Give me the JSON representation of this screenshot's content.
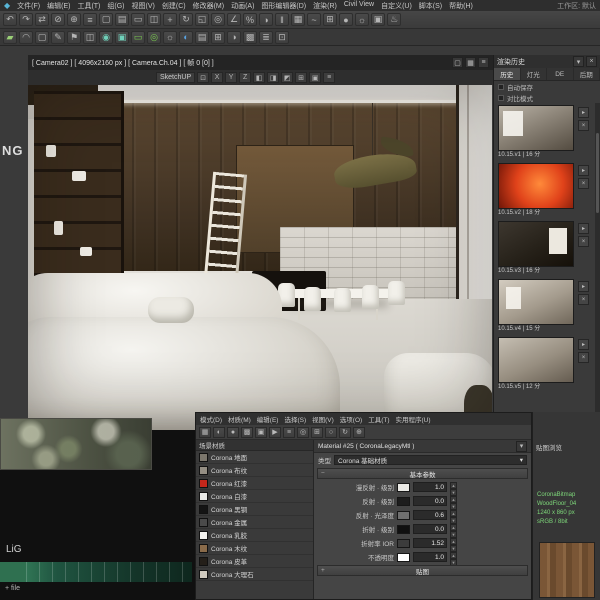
{
  "app": {
    "logo_glyph": "◆",
    "workspace_label": "工作区: 默认"
  },
  "menubar": {
    "items": [
      "文件(F)",
      "编辑(E)",
      "工具(T)",
      "组(G)",
      "视图(V)",
      "创建(C)",
      "修改器(M)",
      "动画(A)",
      "图形编辑器(D)",
      "渲染(R)",
      "Civil View",
      "自定义(U)",
      "脚本(S)",
      "帮助(H)"
    ]
  },
  "toolbar_main": {
    "icons": [
      {
        "name": "undo-icon",
        "glyph": "↶"
      },
      {
        "name": "redo-icon",
        "glyph": "↷"
      },
      {
        "name": "select-and-link-icon",
        "glyph": "⇄"
      },
      {
        "name": "unlink-selection-icon",
        "glyph": "⊘"
      },
      {
        "name": "bind-to-space-warp-icon",
        "glyph": "⊕"
      },
      {
        "name": "selection-filter-dropdown",
        "glyph": "≡"
      },
      {
        "name": "select-object-icon",
        "glyph": "▢"
      },
      {
        "name": "select-by-name-icon",
        "glyph": "▤"
      },
      {
        "name": "rectangular-selection-icon",
        "glyph": "▭"
      },
      {
        "name": "window-crossing-icon",
        "glyph": "◫"
      },
      {
        "name": "select-and-move-icon",
        "glyph": "+"
      },
      {
        "name": "select-and-rotate-icon",
        "glyph": "↻"
      },
      {
        "name": "select-and-scale-icon",
        "glyph": "◱"
      },
      {
        "name": "snap-toggle-icon",
        "glyph": "◎"
      },
      {
        "name": "angle-snap-icon",
        "glyph": "∠"
      },
      {
        "name": "percent-snap-icon",
        "glyph": "%"
      },
      {
        "name": "mirror-icon",
        "glyph": "◑"
      },
      {
        "name": "align-icon",
        "glyph": "‖"
      },
      {
        "name": "layer-manager-icon",
        "glyph": "▦"
      },
      {
        "name": "curve-editor-icon",
        "glyph": "~"
      },
      {
        "name": "schematic-view-icon",
        "glyph": "⊞"
      },
      {
        "name": "material-editor-icon",
        "glyph": "●"
      },
      {
        "name": "render-setup-icon",
        "glyph": "☼"
      },
      {
        "name": "render-frame-window-icon",
        "glyph": "▣"
      },
      {
        "name": "render-production-icon",
        "glyph": "♨"
      }
    ]
  },
  "toolbar_second": {
    "icons": [
      {
        "name": "modeling-tab-icon",
        "glyph": "▰",
        "fg": "#9ad076"
      },
      {
        "name": "freeform-tab-icon",
        "glyph": "◠"
      },
      {
        "name": "selection-tab-icon",
        "glyph": "▢"
      },
      {
        "name": "object-paint-icon",
        "glyph": "✎"
      },
      {
        "name": "populate-icon",
        "glyph": "⚑"
      },
      {
        "name": "viewport-layout-icon",
        "glyph": "◫"
      },
      {
        "name": "isolate-selection-icon",
        "glyph": "◉",
        "fg": "#6fd0b9"
      },
      {
        "name": "capture-viewport-icon",
        "glyph": "▣",
        "fg": "#6fd0b9"
      },
      {
        "name": "safe-frame-icon",
        "glyph": "▭",
        "fg": "#79c94f"
      },
      {
        "name": "camera-icon",
        "glyph": "◎",
        "fg": "#79c94f"
      },
      {
        "name": "light-toggle-icon",
        "glyph": "☼"
      },
      {
        "name": "shading-dropdown-icon",
        "glyph": "◐",
        "fg": "#5aa2e0"
      },
      {
        "name": "edged-faces-icon",
        "glyph": "▤"
      },
      {
        "name": "show-grid-icon",
        "glyph": "⊞"
      },
      {
        "name": "mirror-tool-icon",
        "glyph": "◑"
      },
      {
        "name": "array-icon",
        "glyph": "▩"
      },
      {
        "name": "spacing-tool-icon",
        "glyph": "≣"
      },
      {
        "name": "units-icon",
        "glyph": "⊡"
      }
    ]
  },
  "viewport": {
    "header": "[ Camera02 ] [ 4096x2160 px ] [ Camera.Ch.04 ] [ 帧 0 [0] ]",
    "header_buttons": [
      {
        "name": "maximize-viewport-icon",
        "glyph": "▢"
      },
      {
        "name": "viewport-layout-icon",
        "glyph": "▦"
      },
      {
        "name": "viewport-menu-icon",
        "glyph": "≡"
      }
    ],
    "sub_toolbar": {
      "label": "SketchUP",
      "icons": [
        {
          "name": "snap-3d-icon",
          "glyph": "⊡"
        },
        {
          "name": "axis-x-icon",
          "glyph": "X"
        },
        {
          "name": "axis-y-icon",
          "glyph": "Y"
        },
        {
          "name": "axis-z-icon",
          "glyph": "Z"
        },
        {
          "name": "plane-xy-icon",
          "glyph": "◧"
        },
        {
          "name": "plane-yz-icon",
          "glyph": "◨"
        },
        {
          "name": "plane-zx-icon",
          "glyph": "◩"
        },
        {
          "name": "grid-snap-icon",
          "glyph": "⊞"
        },
        {
          "name": "lock-selection-icon",
          "glyph": "▣"
        },
        {
          "name": "more-tools-icon",
          "glyph": "≡"
        }
      ]
    }
  },
  "watermarks": {
    "left": "NG",
    "bottom": "LiG"
  },
  "right_panel": {
    "title": "渲染历史",
    "title_buttons": [
      {
        "name": "collapse-panel-icon",
        "glyph": "▾"
      },
      {
        "name": "close-panel-icon",
        "glyph": "×"
      }
    ],
    "tabs": [
      {
        "label": "历史",
        "cls": "tab-active"
      },
      {
        "label": "灯光",
        "cls": ""
      },
      {
        "label": "DE",
        "cls": ""
      },
      {
        "label": "后期",
        "cls": ""
      }
    ],
    "options": [
      {
        "label": "自动保存"
      },
      {
        "label": "对比模式"
      }
    ],
    "history": [
      {
        "caption": "10.15.v1 | 16 分",
        "cls": "t1",
        "name": "history-thumb-1"
      },
      {
        "caption": "10.15.v2 | 18 分",
        "cls": "t2",
        "name": "history-thumb-2"
      },
      {
        "caption": "10.15.v3 | 16 分",
        "cls": "t3",
        "name": "history-thumb-3"
      },
      {
        "caption": "10.15.v4 | 15 分",
        "cls": "t4",
        "name": "history-thumb-4"
      },
      {
        "caption": "10.15.v5 | 12 分",
        "cls": "t5",
        "name": "history-thumb-5"
      }
    ]
  },
  "material_editor": {
    "menu": [
      "模式(D)",
      "材质(M)",
      "编辑(E)",
      "选择(S)",
      "视图(V)",
      "选项(O)",
      "工具(T)",
      "实用程序(U)"
    ],
    "toolbar": [
      {
        "name": "show-background-icon",
        "glyph": "▦"
      },
      {
        "name": "backlight-icon",
        "glyph": "◐"
      },
      {
        "name": "sample-type-icon",
        "glyph": "●"
      },
      {
        "name": "checker-background-icon",
        "glyph": "▩"
      },
      {
        "name": "video-color-check-icon",
        "glyph": "▣"
      },
      {
        "name": "make-preview-icon",
        "glyph": "▶"
      },
      {
        "name": "options-icon",
        "glyph": "≡"
      },
      {
        "name": "select-by-material-icon",
        "glyph": "◎"
      },
      {
        "name": "material-map-navigator-icon",
        "glyph": "⊞"
      },
      {
        "name": "get-material-icon",
        "glyph": "○"
      },
      {
        "name": "put-to-scene-icon",
        "glyph": "↻"
      },
      {
        "name": "assign-to-selection-icon",
        "glyph": "⊕"
      }
    ],
    "left": {
      "header": "场景材质",
      "materials": [
        {
          "name": "Corona 地面",
          "color": "#7b766c"
        },
        {
          "name": "Corona 布纹",
          "color": "#948e83"
        },
        {
          "name": "Corona 红漆",
          "color": "#c5271b"
        },
        {
          "name": "Corona 白漆",
          "color": "#e9e9e6"
        },
        {
          "name": "Corona 黑钢",
          "color": "#141414"
        },
        {
          "name": "Corona 金属",
          "color": "#4a4a4a"
        },
        {
          "name": "Corona 乳胶",
          "color": "#f2f1ee"
        },
        {
          "name": "Corona 木纹",
          "color": "#8a6b4a"
        },
        {
          "name": "Corona 皮革",
          "color": "#241f19"
        },
        {
          "name": "Corona 大理石",
          "color": "#cfcabf"
        }
      ]
    },
    "params": {
      "header": "Material #25 ( CoronaLegacyMtl )",
      "header_button_glyph": "▾",
      "type_label": "类型",
      "type_value": "Corona 基础材质",
      "rollout": "基本参数",
      "rollout_minus": "−",
      "rows": [
        {
          "label": "漫反射 · 级别",
          "value": "1.0",
          "swatch": "#e9e8e4"
        },
        {
          "label": "反射 · 级别",
          "value": "0.0",
          "swatch": "#1d1d1d"
        },
        {
          "label": "反射 · 光泽度",
          "value": "0.6",
          "swatch": "#6f6f6f"
        },
        {
          "label": "折射 · 级别",
          "value": "0.0",
          "swatch": "#101010"
        },
        {
          "label": "折射率 IOR",
          "value": "1.52",
          "swatch": "#3c3c3c"
        },
        {
          "label": "不透明度",
          "value": "1.0",
          "swatch": "#ffffff"
        }
      ],
      "rollout2": "贴图"
    }
  },
  "map_panel": {
    "title": "贴图浏览",
    "info_lines": [
      "CoronaBitmap",
      "WoodFloor_04",
      "1240 x 860 px",
      "sRGB / 8bit"
    ]
  },
  "status": {
    "file_label": "+ file"
  },
  "colors": {
    "timeline_green": "#2f7050",
    "accent_red": "#c5271b"
  }
}
